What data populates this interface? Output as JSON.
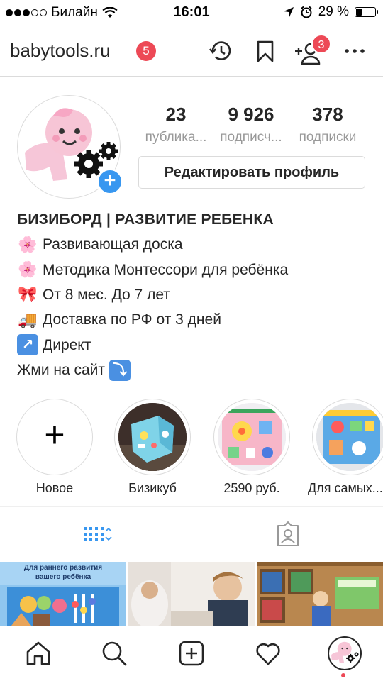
{
  "status_bar": {
    "carrier": "Билайн",
    "time": "16:01",
    "battery": "29 %",
    "battery_level": 0.29,
    "icons": [
      "signal-dots-icon",
      "wifi-icon",
      "location-arrow-icon",
      "alarm-icon",
      "battery-icon"
    ]
  },
  "header": {
    "username": "babytools.ru",
    "notification_count": "5",
    "people_badge_count": "3",
    "icons": [
      "history-icon",
      "bookmark-icon",
      "add-person-icon",
      "more-icon"
    ]
  },
  "profile": {
    "stats": [
      {
        "value": "23",
        "label": "публика..."
      },
      {
        "value": "9 926",
        "label": "подписч..."
      },
      {
        "value": "378",
        "label": "подписки"
      }
    ],
    "edit_button": "Редактировать профиль",
    "add_story_symbol": "+"
  },
  "bio": {
    "name": "БИЗИБОРД | РАЗВИТИЕ РЕБЕНКА",
    "lines": [
      {
        "emoji": "🌸",
        "text": "Развивающая доска"
      },
      {
        "emoji": "🌸",
        "text": "Методика Монтессори для ребёнка"
      },
      {
        "emoji": "🎀",
        "text": "От 8 мес. До 7 лет"
      },
      {
        "emoji": "🚚",
        "text": "Доставка по РФ от 3 дней"
      },
      {
        "emoji": "↗",
        "text": "Директ"
      },
      {
        "emoji": "⤵",
        "text": "Жми на сайт"
      }
    ]
  },
  "highlights": [
    {
      "label": "Новое",
      "symbol": "+"
    },
    {
      "label": "Бизикуб"
    },
    {
      "label": "2590 руб."
    },
    {
      "label": "Для самых..."
    }
  ],
  "grid": {
    "first_tile_caption_1": "Для раннего развития",
    "first_tile_caption_2": "вашего ребёнка"
  },
  "tabs": [
    "grid-tab",
    "tagged-tab"
  ],
  "bottom_nav": [
    "home-icon",
    "search-icon",
    "new-post-icon",
    "activity-icon",
    "profile-icon"
  ],
  "colors": {
    "accent_blue": "#3897f0",
    "badge_red": "#ed4956",
    "text": "#262626",
    "muted": "#999999",
    "border": "#dbdbdb"
  }
}
